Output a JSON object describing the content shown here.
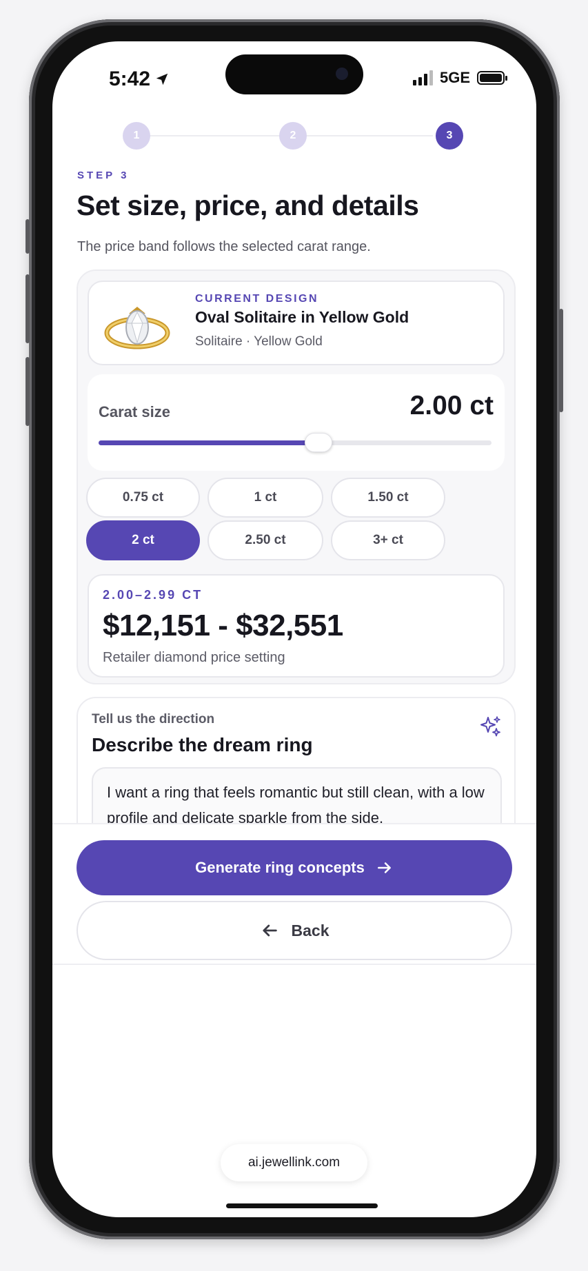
{
  "status_bar": {
    "time": "5:42",
    "network": "5GE"
  },
  "stepper": {
    "steps": [
      "1",
      "2",
      "3"
    ],
    "active": 3
  },
  "header": {
    "eyebrow": "STEP 3",
    "title": "Set size, price, and details",
    "subtitle": "The price band follows the selected carat range."
  },
  "design": {
    "eyebrow": "CURRENT DESIGN",
    "name": "Oval Solitaire in Yellow Gold",
    "meta": "Solitaire · Yellow Gold"
  },
  "carat": {
    "label": "Carat size",
    "value": "2.00 ct",
    "slider_fraction": 0.56
  },
  "carat_options": {
    "options": [
      "0.75 ct",
      "1 ct",
      "1.50 ct",
      "2 ct",
      "2.50 ct",
      "3+ ct"
    ],
    "selected": "2 ct"
  },
  "price": {
    "band": "2.00–2.99 CT",
    "range": "$12,151 - $32,551",
    "note": "Retailer diamond price setting"
  },
  "prompt": {
    "eyebrow": "Tell us the direction",
    "title": "Describe the dream ring",
    "text": "I want a ring that feels romantic but still clean, with a low profile and delicate sparkle from the side."
  },
  "actions": {
    "primary_label": "Generate ring concepts",
    "secondary_label": "Back"
  },
  "browser": {
    "url": "ai.jewellink.com"
  },
  "colors": {
    "accent": "#5647b3",
    "accent_light": "#d9d4ef"
  }
}
